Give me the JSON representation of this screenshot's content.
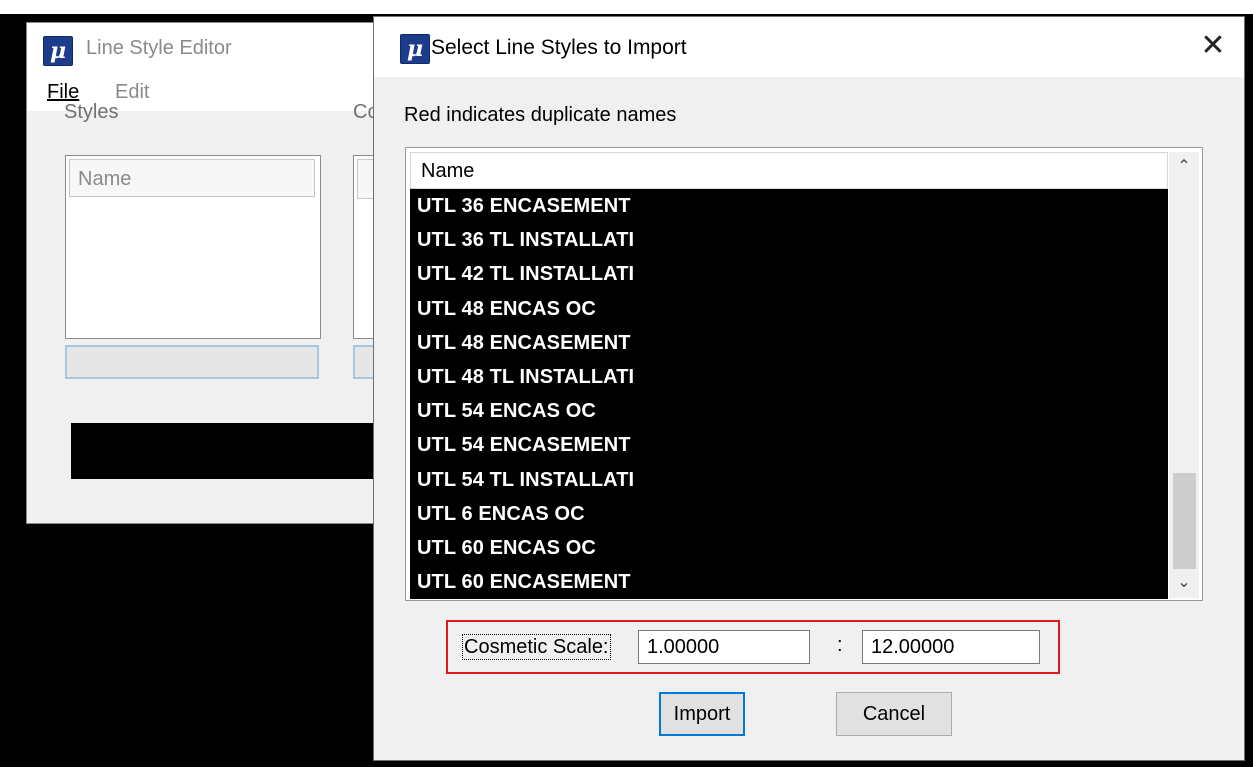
{
  "background_window": {
    "title": "Line Style Editor",
    "icon": "microstation-logo-icon",
    "menu": {
      "file": "File",
      "edit": "Edit"
    },
    "styles_label": "Styles",
    "second_label_partial": "Co",
    "list_header": "Name"
  },
  "dialog": {
    "title": "Select Line Styles to Import",
    "icon": "microstation-logo-icon",
    "close": "✕",
    "subtitle": "Red indicates duplicate names",
    "list": {
      "header": "Name",
      "rows": [
        "UTL 36 ENCASEMENT",
        "UTL 36 TL INSTALLATI",
        "UTL 42 TL INSTALLATI",
        "UTL 48 ENCAS OC",
        "UTL 48 ENCASEMENT",
        "UTL 48 TL INSTALLATI",
        "UTL 54 ENCAS OC",
        "UTL 54 ENCASEMENT",
        "UTL 54 TL INSTALLATI",
        "UTL 6 ENCAS OC",
        "UTL 60 ENCAS OC",
        "UTL 60 ENCASEMENT"
      ],
      "selection_color": "#000000"
    },
    "scale": {
      "label": "Cosmetic Scale:",
      "value1": "1.00000",
      "separator": ":",
      "value2": "12.00000",
      "highlight_color": "#e0191e"
    },
    "buttons": {
      "import": "Import",
      "cancel": "Cancel"
    }
  }
}
